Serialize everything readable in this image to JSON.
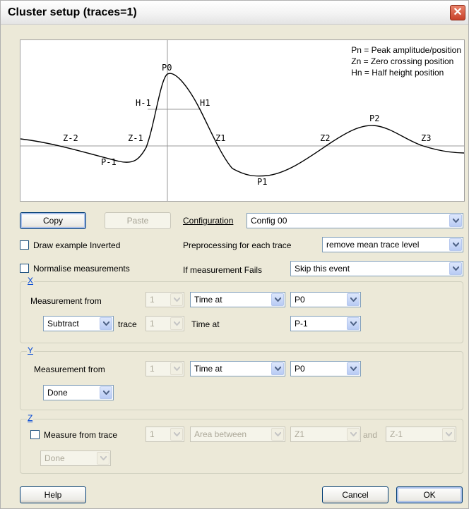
{
  "window": {
    "title": "Cluster setup (traces=1)",
    "close_icon": "close-icon"
  },
  "preview": {
    "legend": [
      "Pn = Peak amplitude/position",
      "Zn = Zero crossing position",
      "Hn = Half height position"
    ],
    "labels": {
      "p0": "P0",
      "h_1": "H-1",
      "h1": "H1",
      "z_2": "Z-2",
      "z_1": "Z-1",
      "z1": "Z1",
      "p_1": "P-1",
      "p1": "P1",
      "z2": "Z2",
      "p2": "P2",
      "z3": "Z3"
    }
  },
  "toolbar": {
    "copy": "Copy",
    "paste": "Paste"
  },
  "configuration": {
    "label": "Configuration",
    "value": "Config 00"
  },
  "options": {
    "draw_inverted": "Draw example Inverted",
    "normalise": "Normalise measurements",
    "preprocessing_label": "Preprocessing for each trace",
    "preprocessing_value": "remove mean trace level",
    "fails_label": "If measurement Fails",
    "fails_value": "Skip this event"
  },
  "x_group": {
    "label": "X",
    "measurement_from": "Measurement from",
    "trace_num": "1",
    "measure_type": "Time at",
    "point": "P0",
    "op": "Subtract",
    "trace_label": "trace",
    "trace_num2": "1",
    "time_at2": "Time at",
    "point2": "P-1"
  },
  "y_group": {
    "label": "Y",
    "measurement_from": "Measurement from",
    "trace_num": "1",
    "measure_type": "Time at",
    "point": "P0",
    "op": "Done"
  },
  "z_group": {
    "label": "Z",
    "measure_from_trace": "Measure from trace",
    "trace_num": "1",
    "measure_type": "Area between",
    "point1": "Z1",
    "and_label": "and",
    "point2": "Z-1",
    "op": "Done"
  },
  "footer": {
    "help": "Help",
    "cancel": "Cancel",
    "ok": "OK"
  }
}
